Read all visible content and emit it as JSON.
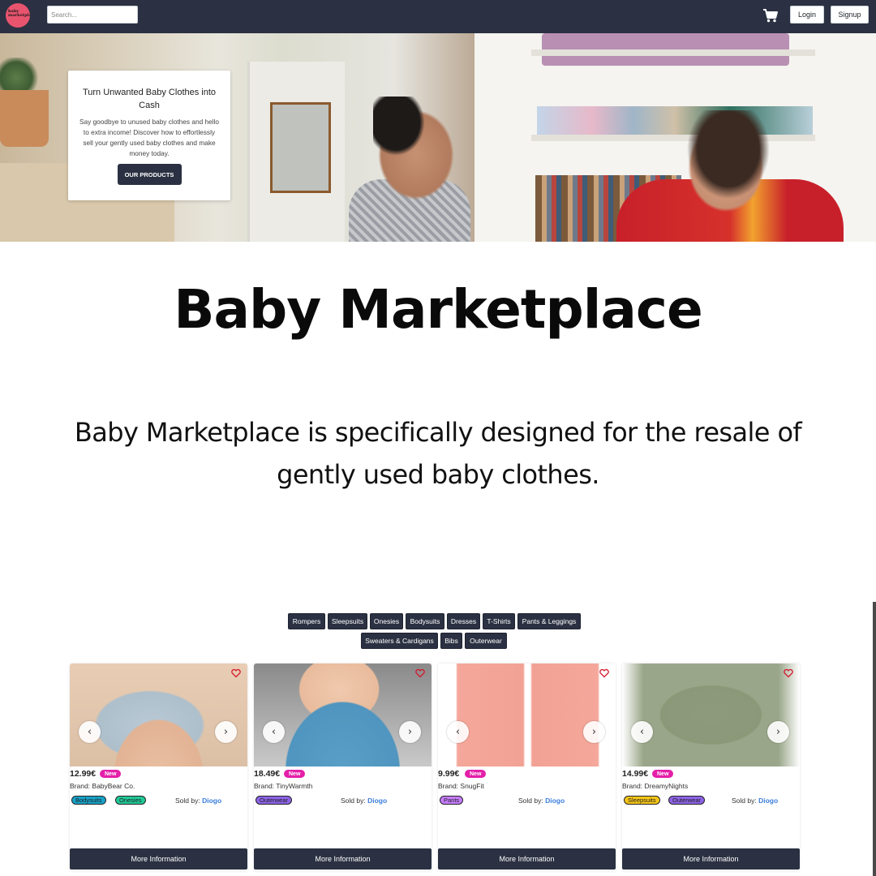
{
  "nav": {
    "logo_text": "baby\nmarketplace",
    "search_placeholder": "Search...",
    "login_label": "Login",
    "signup_label": "Signup",
    "cart_icon": "shopping-cart-icon"
  },
  "hero": {
    "title": "Turn Unwanted Baby Clothes into Cash",
    "text": "Say goodbye to unused baby clothes and hello to extra income! Discover how to effortlessly sell your gently used baby clothes and make money today.",
    "button_label": "OUR PRODUCTS"
  },
  "main": {
    "title": "Baby Marketplace",
    "description": "Baby Marketplace is specifically designed for the resale of gently used baby clothes."
  },
  "categories": [
    "Rompers",
    "Sleepsuits",
    "Onesies",
    "Bodysuits",
    "Dresses",
    "T-Shirts",
    "Pants & Leggings",
    "Sweaters & Cardigans",
    "Bibs",
    "Outerwear"
  ],
  "products": [
    {
      "price": "12.99€",
      "badge": "New",
      "brand": "Brand: BabyBear Co.",
      "tags": [
        {
          "label": "Bodysuits",
          "color": "#17a2c8"
        },
        {
          "label": "Onesies",
          "color": "#20c997"
        }
      ],
      "sold_by_label": "Sold by:",
      "seller": "Diogo",
      "more_label": "More Information"
    },
    {
      "price": "18.49€",
      "badge": "New",
      "brand": "Brand: TinyWarmth",
      "tags": [
        {
          "label": "Outerwear",
          "color": "#8c63e6"
        }
      ],
      "sold_by_label": "Sold by:",
      "seller": "Diogo",
      "more_label": "More Information"
    },
    {
      "price": "9.99€",
      "badge": "New",
      "brand": "Brand: SnugFit",
      "tags": [
        {
          "label": "Pants",
          "color": "#c77dff"
        }
      ],
      "sold_by_label": "Sold by:",
      "seller": "Diogo",
      "more_label": "More Information"
    },
    {
      "price": "14.99€",
      "badge": "New",
      "brand": "Brand: DreamyNights",
      "tags": [
        {
          "label": "Sleepsuits",
          "color": "#f5c518"
        },
        {
          "label": "Outerwear",
          "color": "#8c63e6"
        }
      ],
      "sold_by_label": "Sold by:",
      "seller": "Diogo",
      "more_label": "More Information"
    }
  ],
  "colors": {
    "navbar": "#2b3142",
    "accent_pink": "#e41fa9",
    "seller_link": "#3b7ddd"
  },
  "icons": {
    "prev": "‹",
    "next": "›"
  }
}
